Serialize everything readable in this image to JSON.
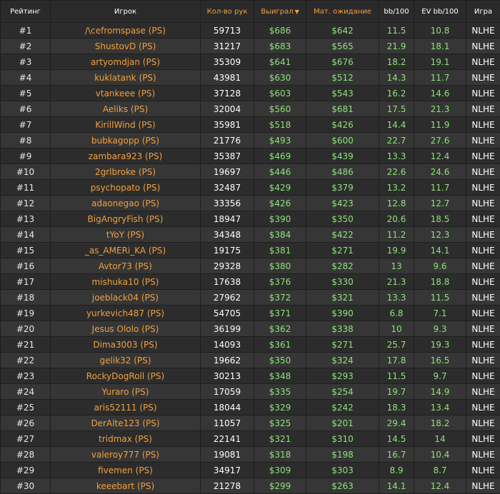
{
  "columns": {
    "rank": "Рейтинг",
    "player": "Игрок",
    "hands": "Кол-во рук",
    "won": "Выиграл",
    "won_sort_arrow": "▼",
    "ev": "Мат. ожидание",
    "bb100": "bb/100",
    "evbb100": "EV bb/100",
    "game": "Игра"
  },
  "colors": {
    "accent": "#f0a040",
    "positive": "#8ee27a",
    "header_bg": "#2a2a2a"
  },
  "rows": [
    {
      "rank": "#1",
      "player": "/\\cefromspase (PS)",
      "hands": "59713",
      "won": "$686",
      "ev": "$642",
      "bb": "11.5",
      "evbb": "10.8",
      "game": "NLHE"
    },
    {
      "rank": "#2",
      "player": "ShustovD (PS)",
      "hands": "31217",
      "won": "$683",
      "ev": "$565",
      "bb": "21.9",
      "evbb": "18.1",
      "game": "NLHE"
    },
    {
      "rank": "#3",
      "player": "artyomdjan (PS)",
      "hands": "35309",
      "won": "$641",
      "ev": "$676",
      "bb": "18.2",
      "evbb": "19.1",
      "game": "NLHE"
    },
    {
      "rank": "#4",
      "player": "kuklatank (PS)",
      "hands": "43981",
      "won": "$630",
      "ev": "$512",
      "bb": "14.3",
      "evbb": "11.7",
      "game": "NLHE"
    },
    {
      "rank": "#5",
      "player": "vtankeee (PS)",
      "hands": "37128",
      "won": "$603",
      "ev": "$543",
      "bb": "16.2",
      "evbb": "14.6",
      "game": "NLHE"
    },
    {
      "rank": "#6",
      "player": "Aeliks (PS)",
      "hands": "32004",
      "won": "$560",
      "ev": "$681",
      "bb": "17.5",
      "evbb": "21.3",
      "game": "NLHE"
    },
    {
      "rank": "#7",
      "player": "KirillWind (PS)",
      "hands": "35981",
      "won": "$518",
      "ev": "$426",
      "bb": "14.4",
      "evbb": "11.9",
      "game": "NLHE"
    },
    {
      "rank": "#8",
      "player": "bubkagopp (PS)",
      "hands": "21776",
      "won": "$493",
      "ev": "$600",
      "bb": "22.7",
      "evbb": "27.6",
      "game": "NLHE"
    },
    {
      "rank": "#9",
      "player": "zambara923 (PS)",
      "hands": "35387",
      "won": "$469",
      "ev": "$439",
      "bb": "13.3",
      "evbb": "12.4",
      "game": "NLHE"
    },
    {
      "rank": "#10",
      "player": "2grlbroke (PS)",
      "hands": "19697",
      "won": "$446",
      "ev": "$486",
      "bb": "22.6",
      "evbb": "24.6",
      "game": "NLHE"
    },
    {
      "rank": "#11",
      "player": "psychopato (PS)",
      "hands": "32487",
      "won": "$429",
      "ev": "$379",
      "bb": "13.2",
      "evbb": "11.7",
      "game": "NLHE"
    },
    {
      "rank": "#12",
      "player": "adaonegao (PS)",
      "hands": "33356",
      "won": "$426",
      "ev": "$423",
      "bb": "12.8",
      "evbb": "12.7",
      "game": "NLHE"
    },
    {
      "rank": "#13",
      "player": "BigAngryFish (PS)",
      "hands": "18947",
      "won": "$390",
      "ev": "$350",
      "bb": "20.6",
      "evbb": "18.5",
      "game": "NLHE"
    },
    {
      "rank": "#14",
      "player": "tYoY (PS)",
      "hands": "34348",
      "won": "$384",
      "ev": "$422",
      "bb": "11.2",
      "evbb": "12.3",
      "game": "NLHE"
    },
    {
      "rank": "#15",
      "player": "_as_AMERi_KA (PS)",
      "hands": "19175",
      "won": "$381",
      "ev": "$271",
      "bb": "19.9",
      "evbb": "14.1",
      "game": "NLHE"
    },
    {
      "rank": "#16",
      "player": "Avtor73 (PS)",
      "hands": "29328",
      "won": "$380",
      "ev": "$282",
      "bb": "13",
      "evbb": "9.6",
      "game": "NLHE"
    },
    {
      "rank": "#17",
      "player": "mishuka10 (PS)",
      "hands": "17638",
      "won": "$376",
      "ev": "$330",
      "bb": "21.3",
      "evbb": "18.8",
      "game": "NLHE"
    },
    {
      "rank": "#18",
      "player": "joeblack04 (PS)",
      "hands": "27962",
      "won": "$372",
      "ev": "$321",
      "bb": "13.3",
      "evbb": "11.5",
      "game": "NLHE"
    },
    {
      "rank": "#19",
      "player": "yurkevich487 (PS)",
      "hands": "54705",
      "won": "$371",
      "ev": "$390",
      "bb": "6.8",
      "evbb": "7.1",
      "game": "NLHE"
    },
    {
      "rank": "#20",
      "player": "Jesus Ololo (PS)",
      "hands": "36199",
      "won": "$362",
      "ev": "$338",
      "bb": "10",
      "evbb": "9.3",
      "game": "NLHE"
    },
    {
      "rank": "#21",
      "player": "Dima3003 (PS)",
      "hands": "14093",
      "won": "$361",
      "ev": "$271",
      "bb": "25.7",
      "evbb": "19.3",
      "game": "NLHE"
    },
    {
      "rank": "#22",
      "player": "gelik32 (PS)",
      "hands": "19662",
      "won": "$350",
      "ev": "$324",
      "bb": "17.8",
      "evbb": "16.5",
      "game": "NLHE"
    },
    {
      "rank": "#23",
      "player": "RockyDogRoll (PS)",
      "hands": "30213",
      "won": "$348",
      "ev": "$293",
      "bb": "11.5",
      "evbb": "9.7",
      "game": "NLHE"
    },
    {
      "rank": "#24",
      "player": "Yuraro (PS)",
      "hands": "17059",
      "won": "$335",
      "ev": "$254",
      "bb": "19.7",
      "evbb": "14.9",
      "game": "NLHE"
    },
    {
      "rank": "#25",
      "player": "aris52111 (PS)",
      "hands": "18044",
      "won": "$329",
      "ev": "$242",
      "bb": "18.3",
      "evbb": "13.4",
      "game": "NLHE"
    },
    {
      "rank": "#26",
      "player": "DerAlte123 (PS)",
      "hands": "11057",
      "won": "$325",
      "ev": "$201",
      "bb": "29.4",
      "evbb": "18.2",
      "game": "NLHE"
    },
    {
      "rank": "#27",
      "player": "tridmax (PS)",
      "hands": "22141",
      "won": "$321",
      "ev": "$310",
      "bb": "14.5",
      "evbb": "14",
      "game": "NLHE"
    },
    {
      "rank": "#28",
      "player": "valeroy777 (PS)",
      "hands": "19081",
      "won": "$318",
      "ev": "$198",
      "bb": "16.7",
      "evbb": "10.4",
      "game": "NLHE"
    },
    {
      "rank": "#29",
      "player": "fivemen (PS)",
      "hands": "34917",
      "won": "$309",
      "ev": "$303",
      "bb": "8.9",
      "evbb": "8.7",
      "game": "NLHE"
    },
    {
      "rank": "#30",
      "player": "keeebart (PS)",
      "hands": "21278",
      "won": "$299",
      "ev": "$263",
      "bb": "14.1",
      "evbb": "12.4",
      "game": "NLHE"
    }
  ]
}
